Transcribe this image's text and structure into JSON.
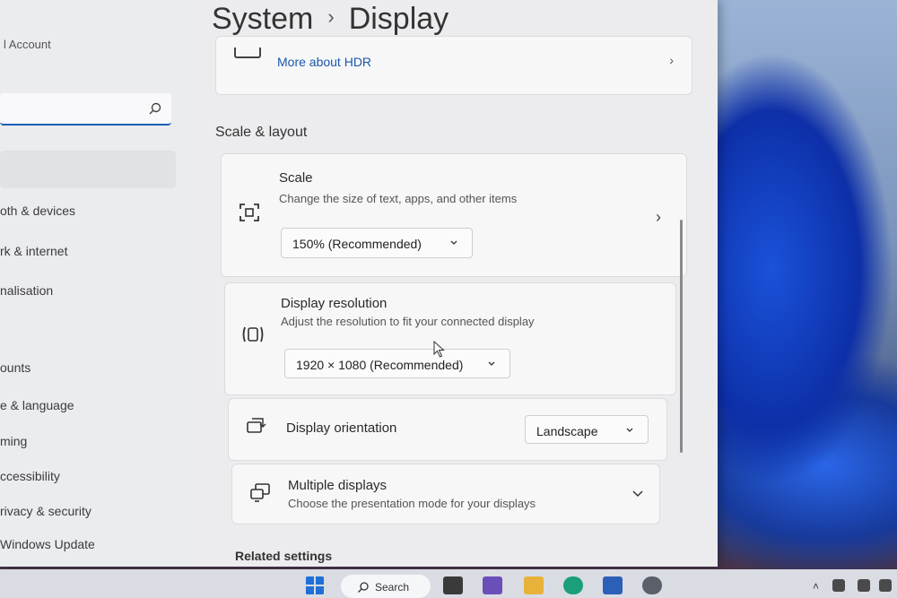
{
  "sidebar": {
    "account": "l Account",
    "items": [
      {
        "label": "oth & devices"
      },
      {
        "label": "rk & internet"
      },
      {
        "label": "nalisation"
      },
      {
        "label": "ounts"
      },
      {
        "label": "e & language"
      },
      {
        "label": "ming"
      },
      {
        "label": "ccessibility"
      },
      {
        "label": "rivacy & security"
      },
      {
        "label": "Windows Update"
      }
    ]
  },
  "breadcrumb": {
    "parent": "System",
    "separator": "›",
    "current": "Display"
  },
  "hdr": {
    "link": "More about HDR"
  },
  "section": {
    "title": "Scale & layout"
  },
  "scale": {
    "title": "Scale",
    "desc": "Change the size of text, apps, and other items",
    "value": "150% (Recommended)"
  },
  "resolution": {
    "title": "Display resolution",
    "desc": "Adjust the resolution to fit your connected display",
    "value": "1920 × 1080 (Recommended)"
  },
  "orientation": {
    "title": "Display orientation",
    "value": "Landscape"
  },
  "multiple": {
    "title": "Multiple displays",
    "desc": "Choose the presentation mode for your displays"
  },
  "related": {
    "title": "Related settings"
  },
  "taskbar": {
    "search": "Search"
  },
  "colors": {
    "accent": "#1a5fb4",
    "link": "#1a56a8"
  }
}
